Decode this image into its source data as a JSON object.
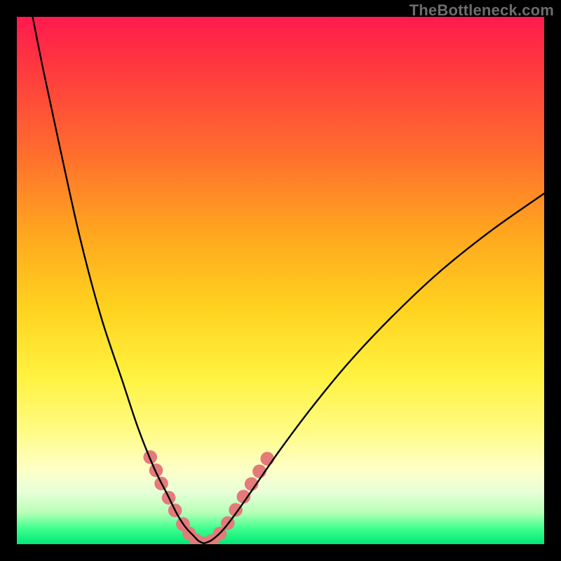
{
  "watermark": "TheBottleneck.com",
  "chart_data": {
    "type": "line",
    "title": "",
    "xlabel": "",
    "ylabel": "",
    "xlim": [
      0,
      100
    ],
    "ylim": [
      0,
      100
    ],
    "grid": false,
    "series": [
      {
        "name": "left-curve",
        "x": [
          3,
          5,
          8,
          12,
          16,
          20,
          23,
          26,
          28.5,
          30.5,
          32,
          33.5,
          34.5,
          35.5
        ],
        "y": [
          100,
          90,
          76,
          58,
          43,
          31,
          22,
          14.5,
          9.5,
          5.5,
          3.2,
          1.6,
          0.6,
          0.15
        ]
      },
      {
        "name": "right-curve",
        "x": [
          35.5,
          37,
          39,
          41.5,
          45,
          50,
          56,
          63,
          71,
          80,
          90,
          100
        ],
        "y": [
          0.15,
          0.8,
          2.6,
          5.8,
          10.8,
          18,
          26,
          34.5,
          43,
          51.5,
          59.5,
          66.5
        ]
      }
    ],
    "blobs": {
      "name": "data-blobs",
      "color": "#e47a7a",
      "points": [
        {
          "x": 25.3,
          "y": 16.5,
          "r": 1.3
        },
        {
          "x": 26.4,
          "y": 14.0,
          "r": 1.3
        },
        {
          "x": 27.4,
          "y": 11.5,
          "r": 1.3
        },
        {
          "x": 28.8,
          "y": 8.8,
          "r": 1.3
        },
        {
          "x": 30.0,
          "y": 6.4,
          "r": 1.3
        },
        {
          "x": 31.5,
          "y": 3.8,
          "r": 1.3
        },
        {
          "x": 32.7,
          "y": 2.0,
          "r": 1.3
        },
        {
          "x": 34.0,
          "y": 0.7,
          "r": 1.3
        },
        {
          "x": 35.5,
          "y": 0.15,
          "r": 1.3
        },
        {
          "x": 37.0,
          "y": 0.6,
          "r": 1.3
        },
        {
          "x": 38.5,
          "y": 2.0,
          "r": 1.3
        },
        {
          "x": 40.0,
          "y": 4.0,
          "r": 1.3
        },
        {
          "x": 41.5,
          "y": 6.5,
          "r": 1.3
        },
        {
          "x": 43.0,
          "y": 9.0,
          "r": 1.3
        },
        {
          "x": 44.5,
          "y": 11.4,
          "r": 1.3
        },
        {
          "x": 46.0,
          "y": 13.8,
          "r": 1.3
        },
        {
          "x": 47.5,
          "y": 16.2,
          "r": 1.3
        }
      ]
    }
  }
}
